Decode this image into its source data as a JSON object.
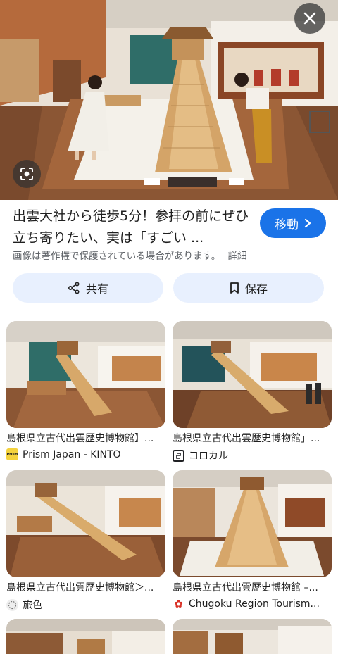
{
  "hero": {
    "image_alt": "museum hall with tall wooden staircase shrine model and two visitors",
    "close_icon": "close-icon",
    "lens_icon": "lens-icon"
  },
  "result": {
    "title": "出雲大社から徒歩5分！参拝の前にぜひ立ち寄りたい、実は「すごい ...",
    "visit_label": "移動",
    "copyright_notice": "画像は著作権で保護されている場合があります。",
    "details_label": "詳細"
  },
  "actions": {
    "share_label": "共有",
    "save_label": "保存"
  },
  "related": [
    {
      "caption": "島根県立古代出雲歴史博物館】...",
      "source": "Prism Japan - KINTO",
      "favicon": "prism-favicon",
      "favicon_text": "Prism"
    },
    {
      "caption": "島根県立古代出雲歴史博物館」...",
      "source": "コロカル",
      "favicon": "corokal-favicon",
      "favicon_text": ""
    },
    {
      "caption": "島根県立古代出雲歴史博物館＞...",
      "source": "旅色",
      "favicon": "tabiiro-favicon",
      "favicon_text": ""
    },
    {
      "caption": "島根県立古代出雲歴史博物館 –...",
      "source": "Chugoku Region Tourism...",
      "favicon": "chugoku-favicon",
      "favicon_text": "✿"
    }
  ],
  "colors": {
    "accent": "#1a73e8",
    "chip_bg": "#e8f0fe",
    "muted_text": "#5f6368"
  }
}
